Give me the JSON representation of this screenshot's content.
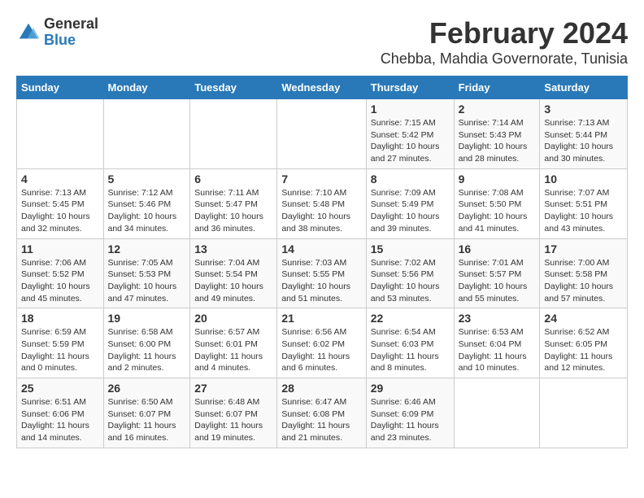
{
  "logo": {
    "general": "General",
    "blue": "Blue"
  },
  "title": "February 2024",
  "subtitle": "Chebba, Mahdia Governorate, Tunisia",
  "headers": [
    "Sunday",
    "Monday",
    "Tuesday",
    "Wednesday",
    "Thursday",
    "Friday",
    "Saturday"
  ],
  "weeks": [
    [
      {
        "day": "",
        "sunrise": "",
        "sunset": "",
        "daylight": ""
      },
      {
        "day": "",
        "sunrise": "",
        "sunset": "",
        "daylight": ""
      },
      {
        "day": "",
        "sunrise": "",
        "sunset": "",
        "daylight": ""
      },
      {
        "day": "",
        "sunrise": "",
        "sunset": "",
        "daylight": ""
      },
      {
        "day": "1",
        "sunrise": "Sunrise: 7:15 AM",
        "sunset": "Sunset: 5:42 PM",
        "daylight": "Daylight: 10 hours and 27 minutes."
      },
      {
        "day": "2",
        "sunrise": "Sunrise: 7:14 AM",
        "sunset": "Sunset: 5:43 PM",
        "daylight": "Daylight: 10 hours and 28 minutes."
      },
      {
        "day": "3",
        "sunrise": "Sunrise: 7:13 AM",
        "sunset": "Sunset: 5:44 PM",
        "daylight": "Daylight: 10 hours and 30 minutes."
      }
    ],
    [
      {
        "day": "4",
        "sunrise": "Sunrise: 7:13 AM",
        "sunset": "Sunset: 5:45 PM",
        "daylight": "Daylight: 10 hours and 32 minutes."
      },
      {
        "day": "5",
        "sunrise": "Sunrise: 7:12 AM",
        "sunset": "Sunset: 5:46 PM",
        "daylight": "Daylight: 10 hours and 34 minutes."
      },
      {
        "day": "6",
        "sunrise": "Sunrise: 7:11 AM",
        "sunset": "Sunset: 5:47 PM",
        "daylight": "Daylight: 10 hours and 36 minutes."
      },
      {
        "day": "7",
        "sunrise": "Sunrise: 7:10 AM",
        "sunset": "Sunset: 5:48 PM",
        "daylight": "Daylight: 10 hours and 38 minutes."
      },
      {
        "day": "8",
        "sunrise": "Sunrise: 7:09 AM",
        "sunset": "Sunset: 5:49 PM",
        "daylight": "Daylight: 10 hours and 39 minutes."
      },
      {
        "day": "9",
        "sunrise": "Sunrise: 7:08 AM",
        "sunset": "Sunset: 5:50 PM",
        "daylight": "Daylight: 10 hours and 41 minutes."
      },
      {
        "day": "10",
        "sunrise": "Sunrise: 7:07 AM",
        "sunset": "Sunset: 5:51 PM",
        "daylight": "Daylight: 10 hours and 43 minutes."
      }
    ],
    [
      {
        "day": "11",
        "sunrise": "Sunrise: 7:06 AM",
        "sunset": "Sunset: 5:52 PM",
        "daylight": "Daylight: 10 hours and 45 minutes."
      },
      {
        "day": "12",
        "sunrise": "Sunrise: 7:05 AM",
        "sunset": "Sunset: 5:53 PM",
        "daylight": "Daylight: 10 hours and 47 minutes."
      },
      {
        "day": "13",
        "sunrise": "Sunrise: 7:04 AM",
        "sunset": "Sunset: 5:54 PM",
        "daylight": "Daylight: 10 hours and 49 minutes."
      },
      {
        "day": "14",
        "sunrise": "Sunrise: 7:03 AM",
        "sunset": "Sunset: 5:55 PM",
        "daylight": "Daylight: 10 hours and 51 minutes."
      },
      {
        "day": "15",
        "sunrise": "Sunrise: 7:02 AM",
        "sunset": "Sunset: 5:56 PM",
        "daylight": "Daylight: 10 hours and 53 minutes."
      },
      {
        "day": "16",
        "sunrise": "Sunrise: 7:01 AM",
        "sunset": "Sunset: 5:57 PM",
        "daylight": "Daylight: 10 hours and 55 minutes."
      },
      {
        "day": "17",
        "sunrise": "Sunrise: 7:00 AM",
        "sunset": "Sunset: 5:58 PM",
        "daylight": "Daylight: 10 hours and 57 minutes."
      }
    ],
    [
      {
        "day": "18",
        "sunrise": "Sunrise: 6:59 AM",
        "sunset": "Sunset: 5:59 PM",
        "daylight": "Daylight: 11 hours and 0 minutes."
      },
      {
        "day": "19",
        "sunrise": "Sunrise: 6:58 AM",
        "sunset": "Sunset: 6:00 PM",
        "daylight": "Daylight: 11 hours and 2 minutes."
      },
      {
        "day": "20",
        "sunrise": "Sunrise: 6:57 AM",
        "sunset": "Sunset: 6:01 PM",
        "daylight": "Daylight: 11 hours and 4 minutes."
      },
      {
        "day": "21",
        "sunrise": "Sunrise: 6:56 AM",
        "sunset": "Sunset: 6:02 PM",
        "daylight": "Daylight: 11 hours and 6 minutes."
      },
      {
        "day": "22",
        "sunrise": "Sunrise: 6:54 AM",
        "sunset": "Sunset: 6:03 PM",
        "daylight": "Daylight: 11 hours and 8 minutes."
      },
      {
        "day": "23",
        "sunrise": "Sunrise: 6:53 AM",
        "sunset": "Sunset: 6:04 PM",
        "daylight": "Daylight: 11 hours and 10 minutes."
      },
      {
        "day": "24",
        "sunrise": "Sunrise: 6:52 AM",
        "sunset": "Sunset: 6:05 PM",
        "daylight": "Daylight: 11 hours and 12 minutes."
      }
    ],
    [
      {
        "day": "25",
        "sunrise": "Sunrise: 6:51 AM",
        "sunset": "Sunset: 6:06 PM",
        "daylight": "Daylight: 11 hours and 14 minutes."
      },
      {
        "day": "26",
        "sunrise": "Sunrise: 6:50 AM",
        "sunset": "Sunset: 6:07 PM",
        "daylight": "Daylight: 11 hours and 16 minutes."
      },
      {
        "day": "27",
        "sunrise": "Sunrise: 6:48 AM",
        "sunset": "Sunset: 6:07 PM",
        "daylight": "Daylight: 11 hours and 19 minutes."
      },
      {
        "day": "28",
        "sunrise": "Sunrise: 6:47 AM",
        "sunset": "Sunset: 6:08 PM",
        "daylight": "Daylight: 11 hours and 21 minutes."
      },
      {
        "day": "29",
        "sunrise": "Sunrise: 6:46 AM",
        "sunset": "Sunset: 6:09 PM",
        "daylight": "Daylight: 11 hours and 23 minutes."
      },
      {
        "day": "",
        "sunrise": "",
        "sunset": "",
        "daylight": ""
      },
      {
        "day": "",
        "sunrise": "",
        "sunset": "",
        "daylight": ""
      }
    ]
  ]
}
